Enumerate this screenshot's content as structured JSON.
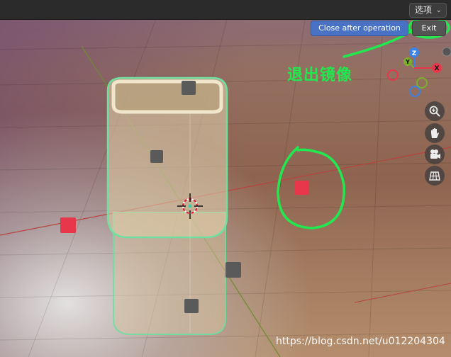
{
  "header": {
    "options_label": "选项",
    "options_chevron": "⌄"
  },
  "toolbar": {
    "close_after_label": "Close after operation",
    "exit_label": "Exit"
  },
  "annotation": {
    "text": "退出镜像"
  },
  "gizmo": {
    "z_label": "Z",
    "y_label": "Y",
    "x_label": "X"
  },
  "nav": {
    "zoom_icon": "zoom-in-icon",
    "pan_icon": "hand-icon",
    "camera_icon": "camera-icon",
    "grid_icon": "grid-icon"
  },
  "watermark": {
    "text": "https://blog.csdn.net/u012204304"
  },
  "colors": {
    "accent_green": "#22e84f",
    "selection_outline": "#6ee0a0",
    "empty_red": "#e8364a",
    "button_blue": "#4a72c4"
  }
}
